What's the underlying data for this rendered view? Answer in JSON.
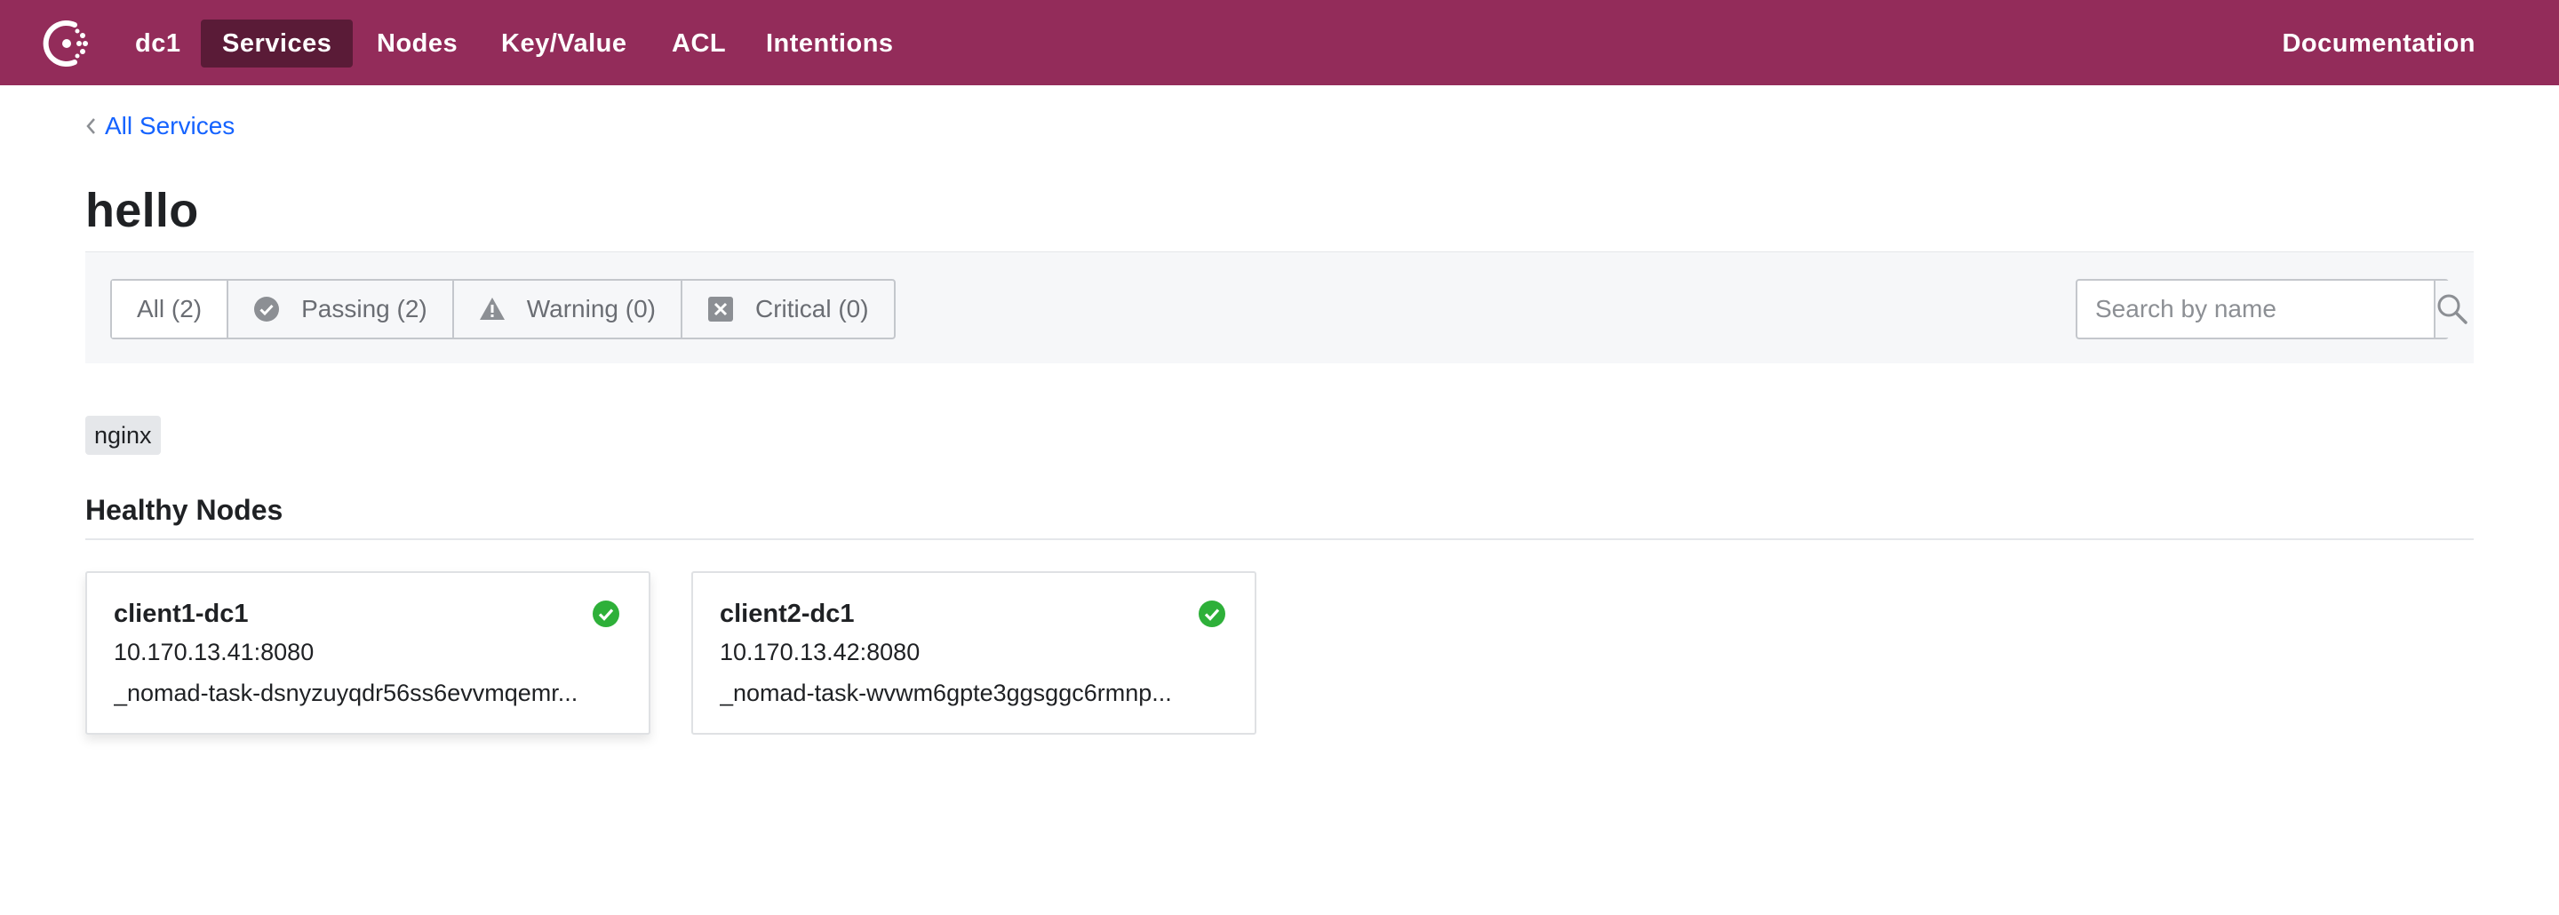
{
  "nav": {
    "datacenter": "dc1",
    "items": [
      {
        "label": "Services",
        "active": true
      },
      {
        "label": "Nodes"
      },
      {
        "label": "Key/Value"
      },
      {
        "label": "ACL"
      },
      {
        "label": "Intentions"
      }
    ],
    "documentation": "Documentation",
    "logo_icon": "consul-logo-icon"
  },
  "breadcrumb": {
    "label": "All Services",
    "icon": "chevron-left-icon"
  },
  "page": {
    "title": "hello"
  },
  "filters": {
    "items": [
      {
        "label": "All (2)",
        "selected": true
      },
      {
        "label": "Passing (2)",
        "icon": "check-circle-icon"
      },
      {
        "label": "Warning (0)",
        "icon": "warning-triangle-icon"
      },
      {
        "label": "Critical (0)",
        "icon": "close-square-icon"
      }
    ],
    "search": {
      "placeholder": "Search by name",
      "value": "",
      "icon": "search-icon"
    }
  },
  "tags": [
    "nginx"
  ],
  "section": {
    "title": "Healthy Nodes"
  },
  "nodes": [
    {
      "name": "client1-dc1",
      "address": "10.170.13.41:8080",
      "id": "_nomad-task-dsnyzuyqdr56ss6evvmqemr...",
      "status": "passing"
    },
    {
      "name": "client2-dc1",
      "address": "10.170.13.42:8080",
      "id": "_nomad-task-wvwm6gpte3ggsggc6rmnp...",
      "status": "passing"
    }
  ],
  "colors": {
    "brand": "#932c5a",
    "brand_dark": "#5a1b37",
    "link": "#1563ff",
    "passing": "#2eb039"
  }
}
